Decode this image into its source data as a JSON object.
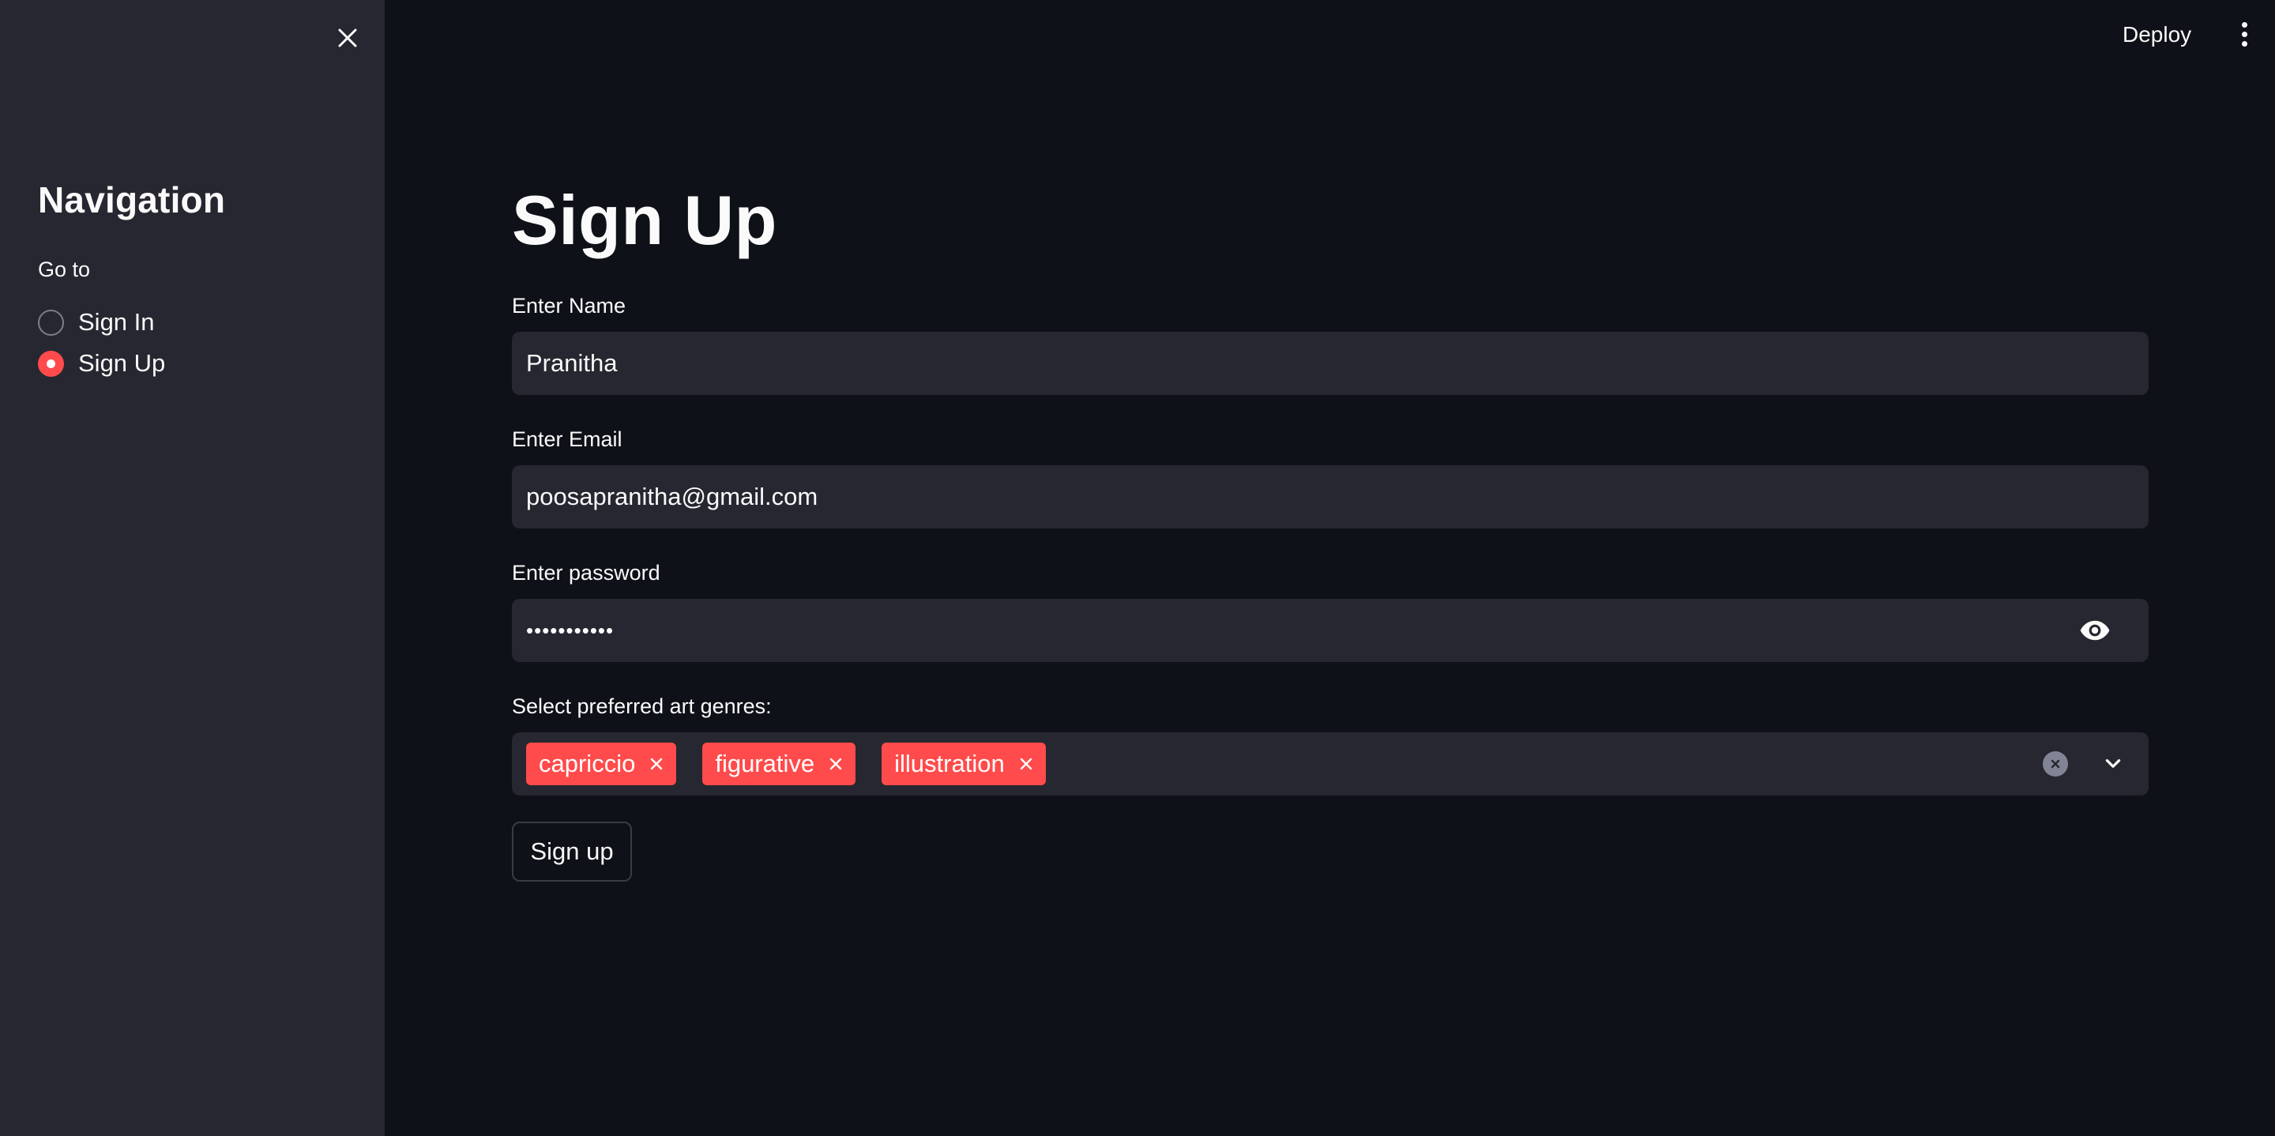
{
  "sidebar": {
    "title": "Navigation",
    "goto_label": "Go to",
    "options": [
      {
        "label": "Sign In",
        "selected": false
      },
      {
        "label": "Sign Up",
        "selected": true
      }
    ]
  },
  "header": {
    "deploy_label": "Deploy"
  },
  "form": {
    "title": "Sign Up",
    "name_label": "Enter Name",
    "name_value": "Pranitha",
    "email_label": "Enter Email",
    "email_value": "poosapranitha@gmail.com",
    "password_label": "Enter password",
    "password_value": "•••••••••••",
    "genres_label": "Select preferred art genres:",
    "genres": [
      "capriccio",
      "figurative",
      "illustration"
    ],
    "submit_label": "Sign up"
  },
  "colors": {
    "background": "#0e1117",
    "sidebar": "#262730",
    "input": "#262730",
    "accent": "#ff4b4b",
    "text": "#fafafa"
  }
}
